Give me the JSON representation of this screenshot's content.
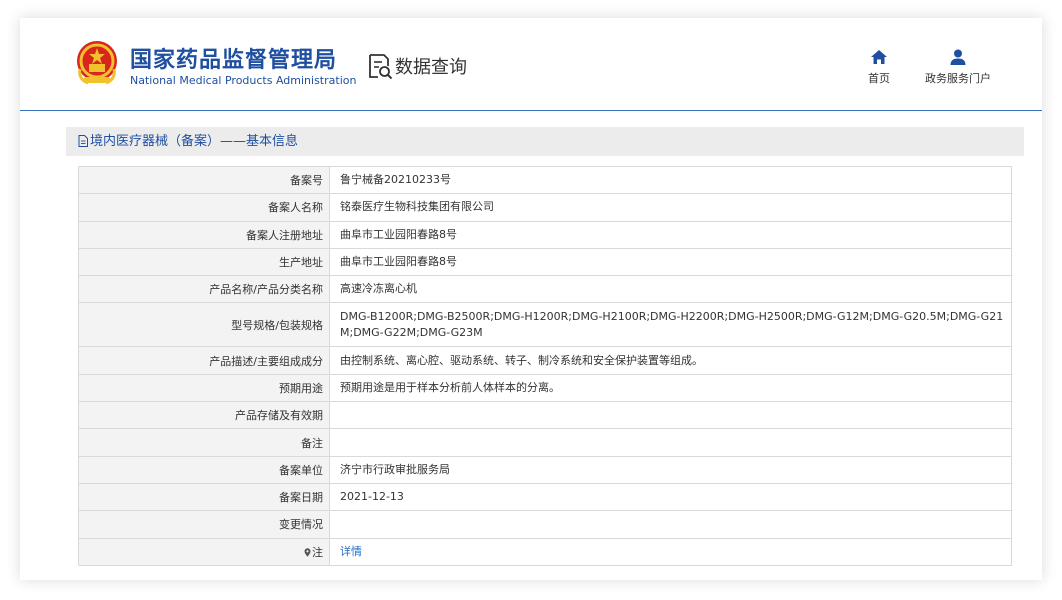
{
  "header": {
    "logo_cn": "国家药品监督管理局",
    "logo_en": "National Medical Products Administration",
    "query_label": "数据查询",
    "nav": [
      {
        "label": "首页",
        "icon": "home-icon"
      },
      {
        "label": "政务服务门户",
        "icon": "user-icon"
      }
    ]
  },
  "panel": {
    "title": "境内医疗器械（备案）——基本信息",
    "rows": [
      {
        "key": "备案号",
        "value": "鲁宁械备20210233号"
      },
      {
        "key": "备案人名称",
        "value": "铭泰医疗生物科技集团有限公司"
      },
      {
        "key": "备案人注册地址",
        "value": "曲阜市工业园阳春路8号"
      },
      {
        "key": "生产地址",
        "value": "曲阜市工业园阳春路8号"
      },
      {
        "key": "产品名称/产品分类名称",
        "value": "高速冷冻离心机"
      },
      {
        "key": "型号规格/包装规格",
        "value": "DMG-B1200R;DMG-B2500R;DMG-H1200R;DMG-H2100R;DMG-H2200R;DMG-H2500R;DMG-G12M;DMG-G20.5M;DMG-G21M;DMG-G22M;DMG-G23M"
      },
      {
        "key": "产品描述/主要组成成分",
        "value": "由控制系统、离心腔、驱动系统、转子、制冷系统和安全保护装置等组成。"
      },
      {
        "key": "预期用途",
        "value": "预期用途是用于样本分析前人体样本的分离。"
      },
      {
        "key": "产品存储及有效期",
        "value": ""
      },
      {
        "key": "备注",
        "value": ""
      },
      {
        "key": "备案单位",
        "value": "济宁市行政审批服务局"
      },
      {
        "key": "备案日期",
        "value": "2021-12-13"
      },
      {
        "key": "变更情况",
        "value": ""
      },
      {
        "key": "注",
        "value": "详情"
      }
    ]
  },
  "colors": {
    "brand_blue": "#1f4fa0",
    "link_blue": "#1f6fc8",
    "header_line": "#3a72b8"
  }
}
